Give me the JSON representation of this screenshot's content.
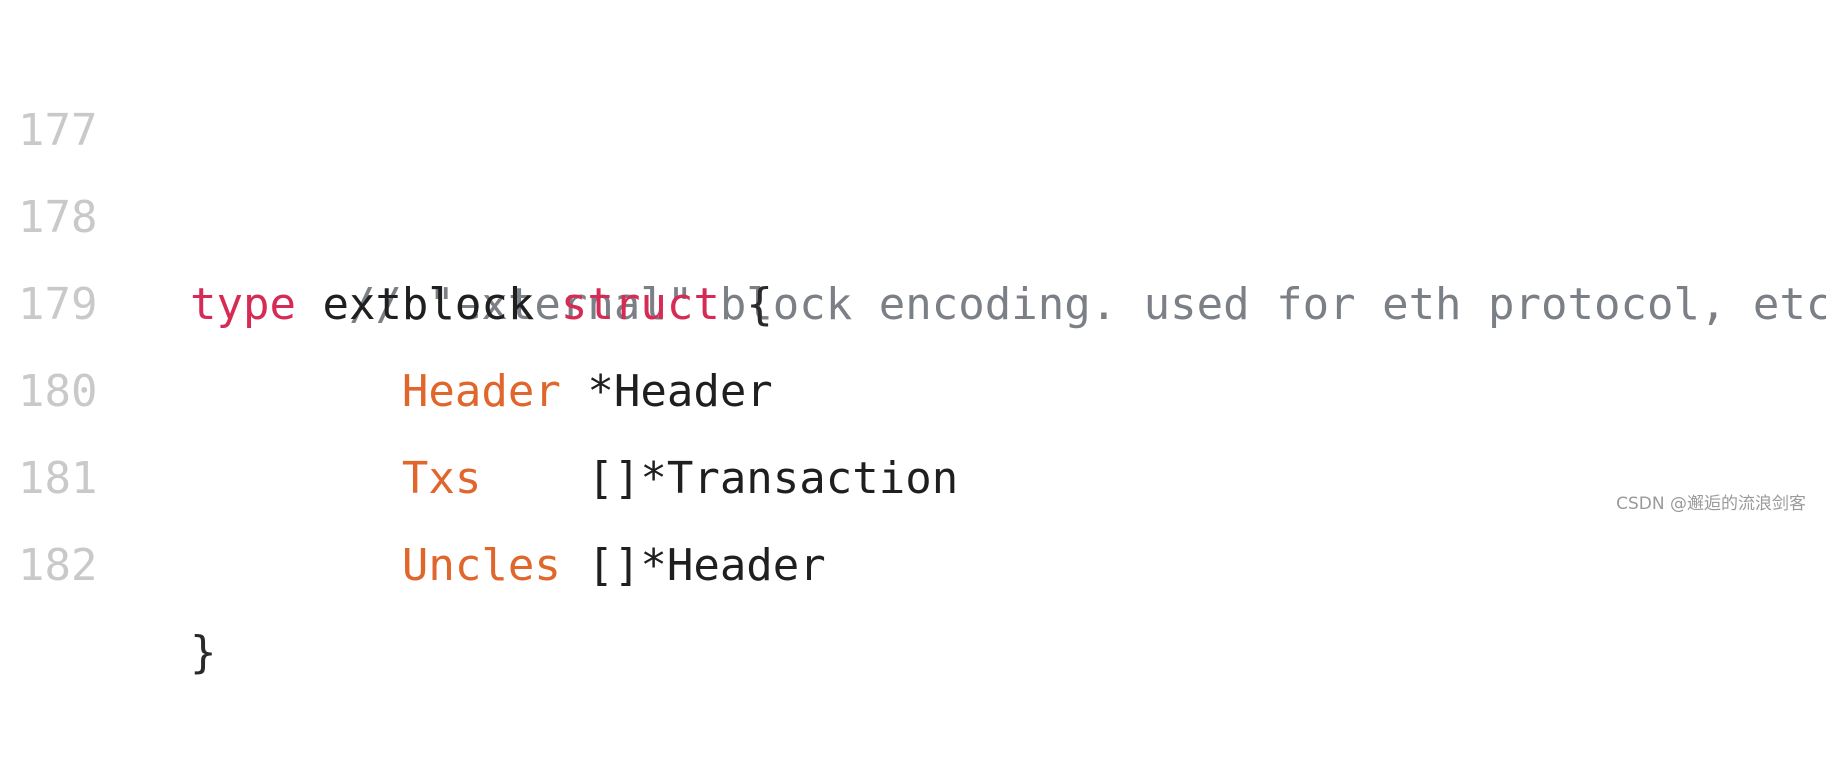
{
  "editor": {
    "lines": [
      {
        "number": "177",
        "tokens": [
          {
            "text": "// \"external\" block encoding. used for eth protocol, etc.",
            "kind": "comment"
          }
        ]
      },
      {
        "number": "178",
        "tokens": [
          {
            "text": "type",
            "kind": "keyword"
          },
          {
            "text": " extblock ",
            "kind": "plain"
          },
          {
            "text": "struct",
            "kind": "keyword"
          },
          {
            "text": " {",
            "kind": "punct"
          }
        ]
      },
      {
        "number": "179",
        "tokens": [
          {
            "text": "        ",
            "kind": "plain"
          },
          {
            "text": "Header",
            "kind": "field"
          },
          {
            "text": " *Header",
            "kind": "plain"
          }
        ]
      },
      {
        "number": "180",
        "tokens": [
          {
            "text": "        ",
            "kind": "plain"
          },
          {
            "text": "Txs",
            "kind": "field"
          },
          {
            "text": "    []*Transaction",
            "kind": "plain"
          }
        ]
      },
      {
        "number": "181",
        "tokens": [
          {
            "text": "        ",
            "kind": "plain"
          },
          {
            "text": "Uncles",
            "kind": "field"
          },
          {
            "text": " []*Header",
            "kind": "plain"
          }
        ]
      },
      {
        "number": "182",
        "tokens": [
          {
            "text": "}",
            "kind": "punct"
          }
        ]
      }
    ]
  },
  "watermark": "CSDN @邂逅的流浪剑客",
  "colors": {
    "comment": "#7b7f86",
    "keyword": "#d52b54",
    "field": "#e0662b",
    "plain": "#1f1f1f",
    "line_number": "#c9c9c9"
  }
}
